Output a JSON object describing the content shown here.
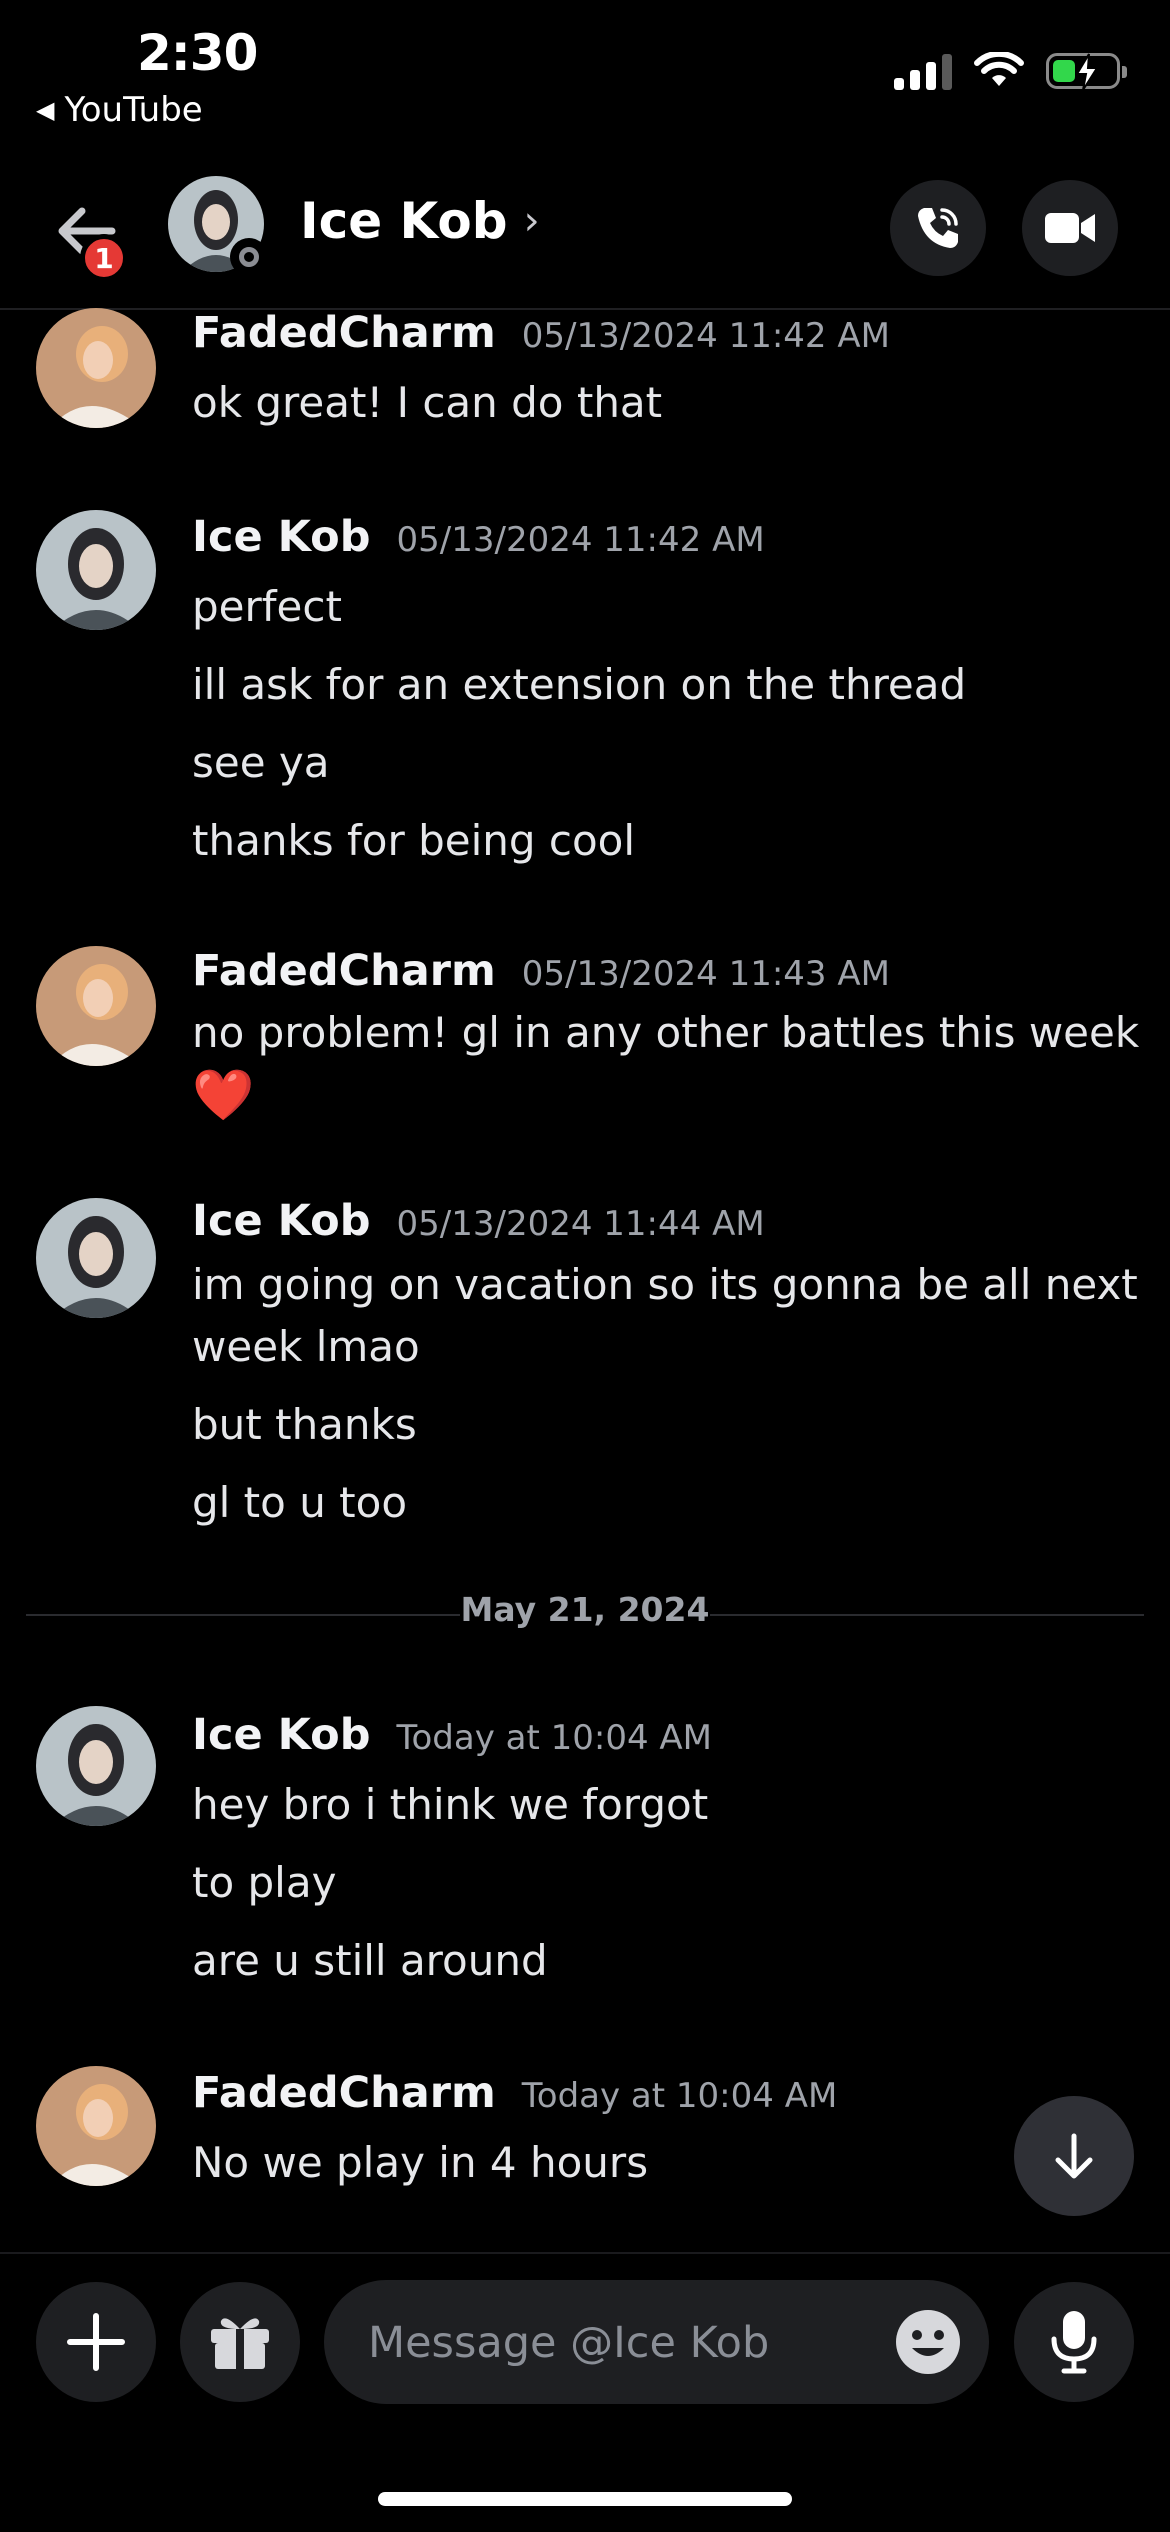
{
  "status_bar": {
    "time": "2:30",
    "back_app": "YouTube"
  },
  "header": {
    "title": "Ice Kob",
    "notification_count": "1"
  },
  "messages": [
    {
      "author": "FadedCharm",
      "timestamp": "05/13/2024 11:42 AM",
      "lines": [
        "ok great! I can do that"
      ]
    },
    {
      "author": "Ice Kob",
      "timestamp": "05/13/2024 11:42 AM",
      "lines": [
        "perfect",
        "ill ask for an extension on the thread",
        "see ya",
        "thanks for being cool"
      ]
    },
    {
      "author": "FadedCharm",
      "timestamp": "05/13/2024 11:43 AM",
      "lines": [
        "no problem! gl in any other battles this week",
        "❤️"
      ]
    },
    {
      "author": "Ice Kob",
      "timestamp": "05/13/2024 11:44 AM",
      "lines": [
        "im going on vacation so its gonna be all next",
        "week lmao",
        "but thanks",
        "gl to u too"
      ]
    },
    {
      "author": "Ice Kob",
      "timestamp": "Today at 10:04 AM",
      "lines": [
        "hey bro i think we forgot",
        "to play",
        "are u still around"
      ]
    },
    {
      "author": "FadedCharm",
      "timestamp": "Today at 10:04 AM",
      "lines": [
        "No we play in 4 hours"
      ]
    }
  ],
  "date_divider": "May 21, 2024",
  "composer": {
    "placeholder": "Message @Ice Kob"
  },
  "colors": {
    "background": "#000000",
    "button_bg": "#1e1f22",
    "badge": "#e53935",
    "battery": "#32d74b"
  }
}
